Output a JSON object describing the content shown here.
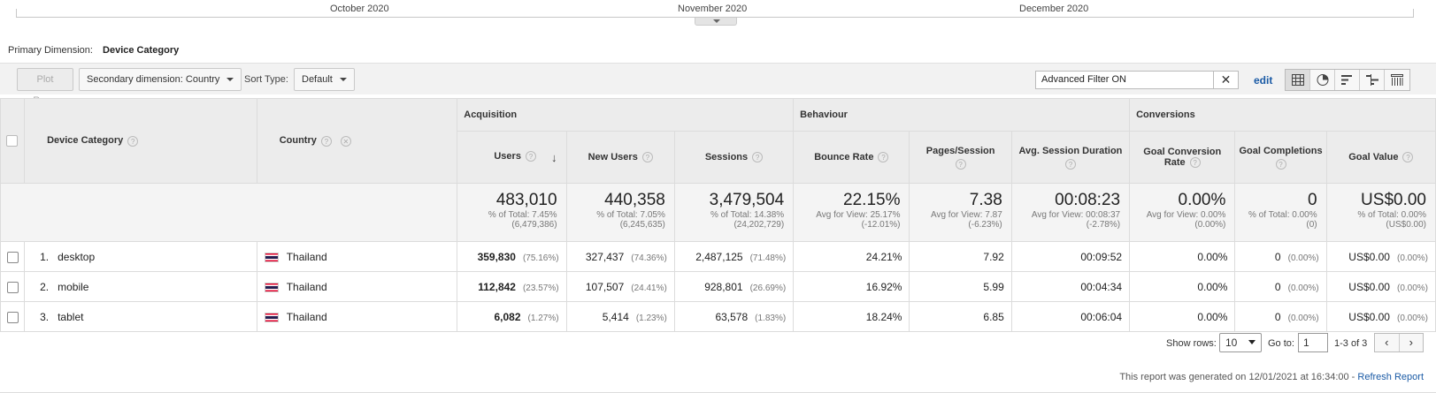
{
  "timeline": {
    "months": [
      "October 2020",
      "November 2020",
      "December 2020"
    ]
  },
  "primary_dimension": {
    "label": "Primary Dimension:",
    "value": "Device Category"
  },
  "toolbar": {
    "plot_rows": "Plot Rows",
    "secondary_dimension": "Secondary dimension: Country",
    "sort_type_label": "Sort Type:",
    "sort_type_value": "Default",
    "filter_value": "Advanced Filter ON",
    "filter_clear": "✕",
    "edit": "edit"
  },
  "table": {
    "group_headers": {
      "acquisition": "Acquisition",
      "behaviour": "Behaviour",
      "conversions": "Conversions"
    },
    "columns": {
      "device_category": "Device Category",
      "country": "Country",
      "users": "Users",
      "new_users": "New Users",
      "sessions": "Sessions",
      "bounce_rate": "Bounce Rate",
      "pages_session": "Pages/Session",
      "avg_session_duration": "Avg. Session Duration",
      "goal_conversion_rate": "Goal Conversion Rate",
      "goal_completions": "Goal Completions",
      "goal_value": "Goal Value"
    },
    "help": "?",
    "remove": "✕",
    "sort_arrow": "↓",
    "totals": {
      "users": {
        "big": "483,010",
        "l1": "% of Total: 7.45%",
        "l2": "(6,479,386)"
      },
      "new_users": {
        "big": "440,358",
        "l1": "% of Total: 7.05%",
        "l2": "(6,245,635)"
      },
      "sessions": {
        "big": "3,479,504",
        "l1": "% of Total: 14.38%",
        "l2": "(24,202,729)"
      },
      "bounce_rate": {
        "big": "22.15%",
        "l1": "Avg for View: 25.17%",
        "l2": "(-12.01%)"
      },
      "pages_session": {
        "big": "7.38",
        "l1": "Avg for View: 7.87",
        "l2": "(-6.23%)"
      },
      "avg_session_duration": {
        "big": "00:08:23",
        "l1": "Avg for View: 00:08:37",
        "l2": "(-2.78%)"
      },
      "goal_conversion_rate": {
        "big": "0.00%",
        "l1": "Avg for View: 0.00%",
        "l2": "(0.00%)"
      },
      "goal_completions": {
        "big": "0",
        "l1": "% of Total: 0.00%",
        "l2": "(0)"
      },
      "goal_value": {
        "big": "US$0.00",
        "l1": "% of Total: 0.00%",
        "l2": "(US$0.00)"
      }
    },
    "rows": [
      {
        "index": "1.",
        "device": "desktop",
        "country": "Thailand",
        "users": "359,830",
        "users_pct": "(75.16%)",
        "new_users": "327,437",
        "new_users_pct": "(74.36%)",
        "sessions": "2,487,125",
        "sessions_pct": "(71.48%)",
        "bounce_rate": "24.21%",
        "pages_session": "7.92",
        "avg_duration": "00:09:52",
        "conv_rate": "0.00%",
        "completions": "0",
        "completions_pct": "(0.00%)",
        "goal_value": "US$0.00",
        "goal_value_pct": "(0.00%)"
      },
      {
        "index": "2.",
        "device": "mobile",
        "country": "Thailand",
        "users": "112,842",
        "users_pct": "(23.57%)",
        "new_users": "107,507",
        "new_users_pct": "(24.41%)",
        "sessions": "928,801",
        "sessions_pct": "(26.69%)",
        "bounce_rate": "16.92%",
        "pages_session": "5.99",
        "avg_duration": "00:04:34",
        "conv_rate": "0.00%",
        "completions": "0",
        "completions_pct": "(0.00%)",
        "goal_value": "US$0.00",
        "goal_value_pct": "(0.00%)"
      },
      {
        "index": "3.",
        "device": "tablet",
        "country": "Thailand",
        "users": "6,082",
        "users_pct": "(1.27%)",
        "new_users": "5,414",
        "new_users_pct": "(1.23%)",
        "sessions": "63,578",
        "sessions_pct": "(1.83%)",
        "bounce_rate": "18.24%",
        "pages_session": "6.85",
        "avg_duration": "00:06:04",
        "conv_rate": "0.00%",
        "completions": "0",
        "completions_pct": "(0.00%)",
        "goal_value": "US$0.00",
        "goal_value_pct": "(0.00%)"
      }
    ]
  },
  "pagination": {
    "show_rows_label": "Show rows:",
    "show_rows_value": "10",
    "goto_label": "Go to:",
    "goto_value": "1",
    "range": "1-3 of 3",
    "prev": "‹",
    "next": "›"
  },
  "footer": {
    "generated": "This report was generated on 12/01/2021 at 16:34:00 - ",
    "refresh": "Refresh Report"
  }
}
